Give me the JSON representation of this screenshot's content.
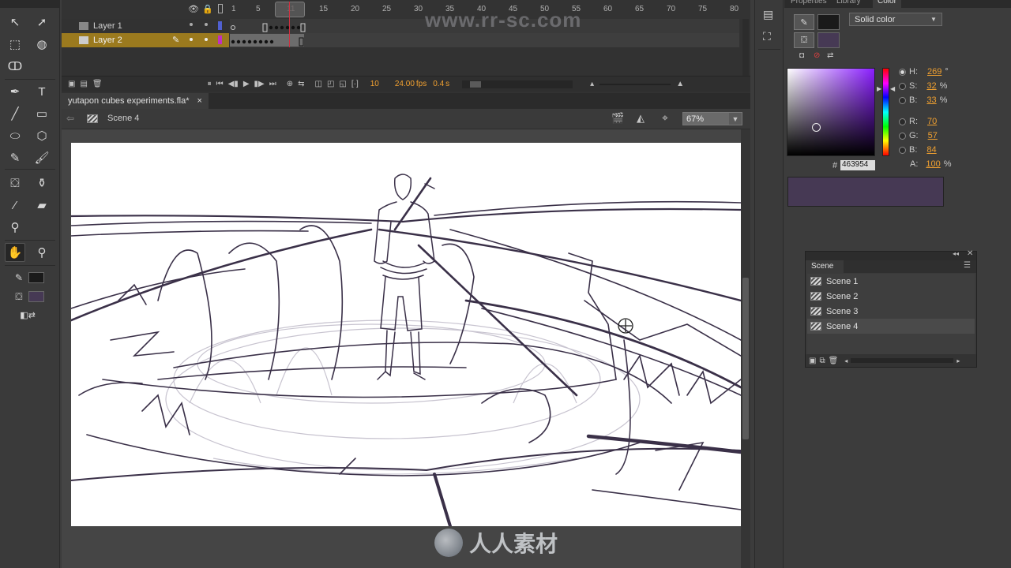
{
  "timeline": {
    "layers": [
      {
        "name": "Layer 1",
        "selected": false
      },
      {
        "name": "Layer 2",
        "selected": true
      }
    ],
    "frame_numbers": [
      "1",
      "5",
      "11",
      "15",
      "20",
      "25",
      "30",
      "35",
      "40",
      "45",
      "50",
      "55",
      "60",
      "65",
      "70",
      "75",
      "80"
    ],
    "current_frame": "10",
    "fps": "24.00",
    "fps_unit": "fps",
    "time": "0.4",
    "time_unit": "s"
  },
  "document": {
    "tab_title": "yutapon cubes experiments.fla*",
    "close_label": "×",
    "scene_name": "Scene 4",
    "zoom": "67%"
  },
  "watermark": {
    "url": "www.rr-sc.com",
    "brand": "人人素材"
  },
  "right_panel": {
    "tabs": [
      "Properties",
      "Library",
      "Color"
    ],
    "active_tab": "Color",
    "color_type": "Solid color",
    "hsb": {
      "h": "269",
      "s": "32",
      "b": "33"
    },
    "h_label": "H:",
    "s_label": "S:",
    "b_label": "B:",
    "deg_unit": "°",
    "pct_unit": "%",
    "rgb": {
      "r": "70",
      "g": "57",
      "b": "84"
    },
    "r_label": "R:",
    "g_label": "G:",
    "b2_label": "B:",
    "hex_label": "#",
    "hex": "463954",
    "alpha_label": "A:",
    "alpha": "100",
    "fill_color": "#463954",
    "stroke_color": "#1a1a1a"
  },
  "scene_panel": {
    "title": "Scene",
    "scenes": [
      "Scene 1",
      "Scene 2",
      "Scene 3",
      "Scene 4"
    ],
    "selected": "Scene 4"
  },
  "colors": {
    "layer_highlight": "#9b7a1e",
    "playhead": "#d03040",
    "sketch_ink": "#3a3048"
  }
}
